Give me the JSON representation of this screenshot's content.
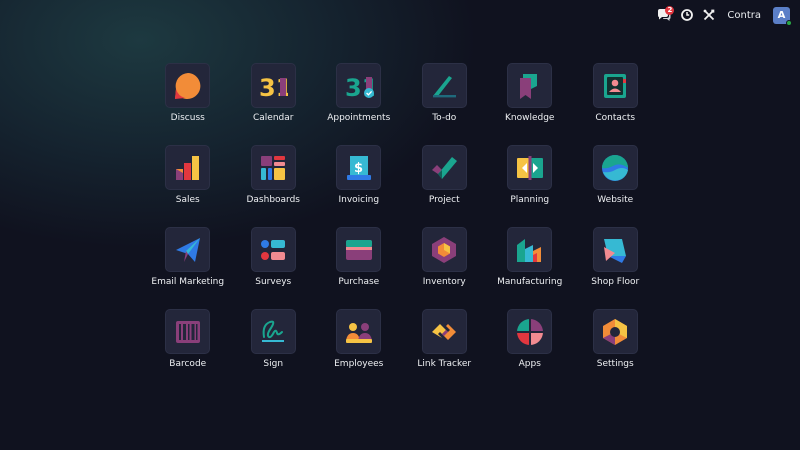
{
  "navbar": {
    "messages_badge": "2",
    "company": "Contra",
    "avatar_letter": "A"
  },
  "apps": [
    {
      "key": "discuss",
      "label": "Discuss",
      "icon": "discuss-icon"
    },
    {
      "key": "calendar",
      "label": "Calendar",
      "icon": "calendar-icon",
      "glyph": "31"
    },
    {
      "key": "appointments",
      "label": "Appointments",
      "icon": "appointments-icon",
      "glyph": "31"
    },
    {
      "key": "todo",
      "label": "To-do",
      "icon": "todo-icon"
    },
    {
      "key": "knowledge",
      "label": "Knowledge",
      "icon": "knowledge-icon"
    },
    {
      "key": "contacts",
      "label": "Contacts",
      "icon": "contacts-icon"
    },
    {
      "key": "sales",
      "label": "Sales",
      "icon": "sales-icon"
    },
    {
      "key": "dashboards",
      "label": "Dashboards",
      "icon": "dashboards-icon"
    },
    {
      "key": "invoicing",
      "label": "Invoicing",
      "icon": "invoicing-icon",
      "glyph": "$"
    },
    {
      "key": "project",
      "label": "Project",
      "icon": "project-icon"
    },
    {
      "key": "planning",
      "label": "Planning",
      "icon": "planning-icon"
    },
    {
      "key": "website",
      "label": "Website",
      "icon": "website-icon"
    },
    {
      "key": "email-marketing",
      "label": "Email Marketing",
      "icon": "email-marketing-icon"
    },
    {
      "key": "surveys",
      "label": "Surveys",
      "icon": "surveys-icon"
    },
    {
      "key": "purchase",
      "label": "Purchase",
      "icon": "purchase-icon"
    },
    {
      "key": "inventory",
      "label": "Inventory",
      "icon": "inventory-icon"
    },
    {
      "key": "manufacturing",
      "label": "Manufacturing",
      "icon": "manufacturing-icon"
    },
    {
      "key": "shop-floor",
      "label": "Shop Floor",
      "icon": "shop-floor-icon"
    },
    {
      "key": "barcode",
      "label": "Barcode",
      "icon": "barcode-icon"
    },
    {
      "key": "sign",
      "label": "Sign",
      "icon": "sign-icon"
    },
    {
      "key": "employees",
      "label": "Employees",
      "icon": "employees-icon"
    },
    {
      "key": "link-tracker",
      "label": "Link Tracker",
      "icon": "link-tracker-icon"
    },
    {
      "key": "apps",
      "label": "Apps",
      "icon": "apps-icon"
    },
    {
      "key": "settings",
      "label": "Settings",
      "icon": "settings-icon"
    }
  ],
  "colors": {
    "orange": "#f28c38",
    "red": "#e2373f",
    "purple": "#8a3f7a",
    "teal": "#1aa58f",
    "cyan": "#36b9d3",
    "blue": "#2f7ae5",
    "yellow": "#f6c344",
    "pink": "#f28b91",
    "tile_bg": "#23263a"
  }
}
